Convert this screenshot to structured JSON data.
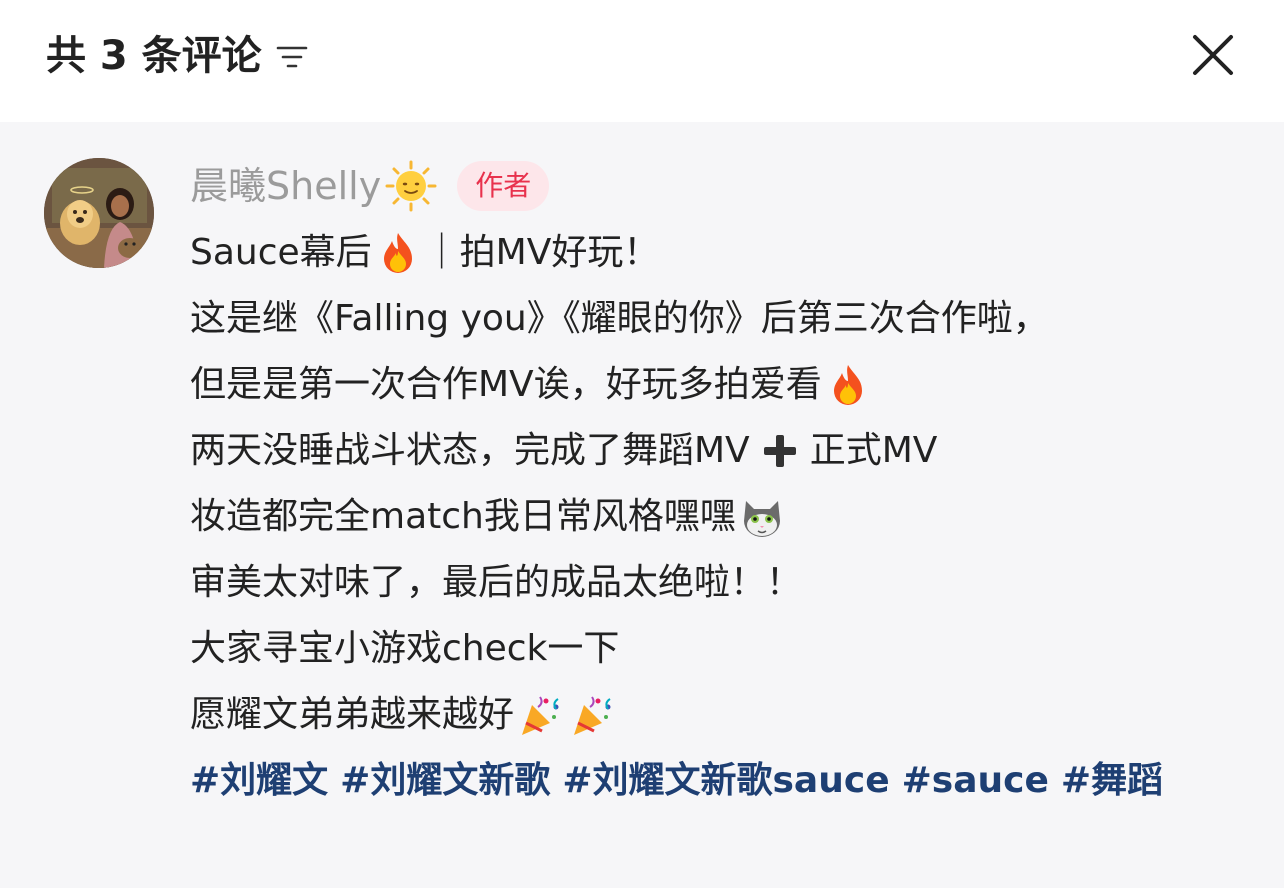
{
  "header": {
    "title": "共 3 条评论"
  },
  "comment": {
    "username": "晨曦Shelly",
    "badge": "作者",
    "lines": {
      "l1a": "Sauce幕后",
      "l1b": "｜拍MV好玩！",
      "l2": "这是继《Falling you》《耀眼的你》后第三次合作啦，",
      "l3": "但是是第一次合作MV诶，好玩多拍爱看",
      "l4a": "两天没睡战斗状态，完成了舞蹈MV",
      "l4b": "正式MV",
      "l5": "妆造都完全match我日常风格嘿嘿",
      "l6": "审美太对味了，最后的成品太绝啦！！",
      "l7": "大家寻宝小游戏check一下",
      "l8": "愿耀文弟弟越来越好"
    },
    "hashtags": [
      "#刘耀文",
      "#刘耀文新歌",
      "#刘耀文新歌sauce",
      "#sauce",
      "#舞蹈"
    ],
    "icons": {
      "sort": "sort-lines-icon",
      "close": "close-icon",
      "sun": "sun-with-face-emoji",
      "fire": "fire-emoji",
      "plus": "heavy-plus-emoji",
      "cat": "cat-face-emoji",
      "party": "party-popper-emoji"
    }
  }
}
